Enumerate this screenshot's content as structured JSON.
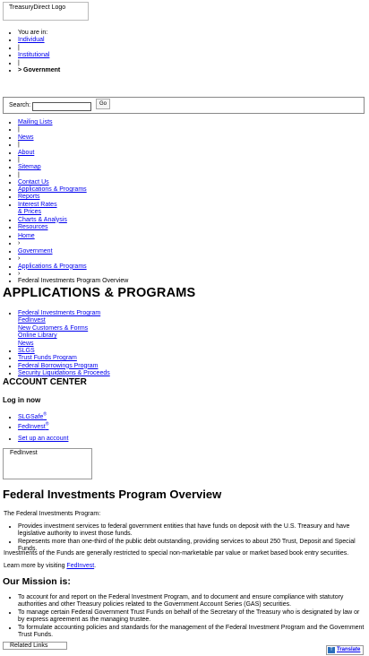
{
  "header": {
    "logo_alt": "TreasuryDirect Logo"
  },
  "you_are_in": {
    "label": "You are in:",
    "items": [
      "Individual",
      "|",
      "Institutional",
      "|"
    ],
    "current": "> Government"
  },
  "search": {
    "label": "Search:",
    "value": "",
    "go_label": "Go"
  },
  "utility_nav": [
    "Mailing Lists",
    "|",
    "News",
    "|",
    "About",
    "|",
    "Sitemap",
    "|",
    "Contact Us"
  ],
  "main_nav": {
    "applications": "Applications & Programs",
    "reports": "Reports",
    "interest_line1": "Interest Rates",
    "interest_line2": "& Prices",
    "charts": "Charts & Analysis",
    "resources": "Resources"
  },
  "breadcrumb": [
    "Home",
    "›",
    "Government",
    "›",
    "Applications & Programs",
    "›",
    "Federal Investments Program Overview"
  ],
  "section_title": "APPLICATIONS & PROGRAMS",
  "sub_nav": {
    "federal_investments_program": "Federal Investments Program",
    "sub_fedinvest": "FedInvest",
    "sub_new_customers": "New Customers & Forms",
    "sub_online_library": "Online Library",
    "sub_news": "News",
    "slgs": "SLGS",
    "trust_funds": "Trust Funds Program",
    "federal_borrowings": "Federal Borrowings Program",
    "security_liquidations": "Security Liquidations & Proceeds"
  },
  "account_center": {
    "title": "ACCOUNT CENTER",
    "login_heading": "Log in now",
    "slgsafe": "SLGSafe",
    "slgsafe_mark": "®",
    "fedinvest": "FedInvest",
    "fedinvest_mark": "®",
    "setup": "Set up an account",
    "box_label": "FedInvest"
  },
  "content": {
    "title": "Federal Investments Program Overview",
    "intro": "The Federal Investments Program:",
    "bullets": [
      "Provides investment services to federal government entities that have funds on deposit with the U.S. Treasury and have legislative authority to invest those funds.",
      "Represents more than one-third of the public debt outstanding, providing services to about 250 Trust, Deposit and Special Funds."
    ],
    "restriction": "Investments of the Funds are generally restricted to special non-marketable par value or market based book entry securities.",
    "learn_more_prefix": "Learn more by visiting ",
    "learn_more_link": "FedInvest",
    "learn_more_suffix": "."
  },
  "mission": {
    "title": "Our Mission is:",
    "items": [
      "To account for and report on the Federal Investment Program, and to document and ensure compliance with statutory authorities and other Treasury policies related to the Government Account Series (GAS) securities.",
      "To manage certain Federal Government Trust Funds on behalf of the Secretary of the Treasury who is designated by law or by express agreement as the managing trustee.",
      "To formulate accounting policies and standards for the management of the Federal Investment Program and the Government Trust Funds."
    ]
  },
  "footer": {
    "related_links": "Related Links",
    "translate": "Translate"
  }
}
